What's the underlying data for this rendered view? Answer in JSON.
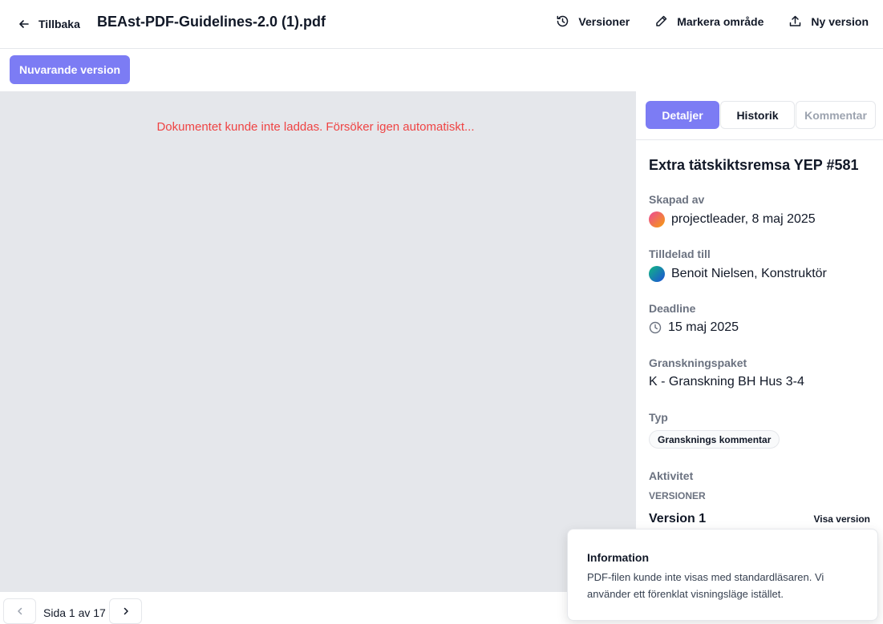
{
  "header": {
    "back_label": "Tillbaka",
    "document_title": "BEAst-PDF-Guidelines-2.0 (1).pdf",
    "actions": {
      "versions": "Versioner",
      "mark_area": "Markera område",
      "new_version": "Ny version"
    }
  },
  "version_bar": {
    "current_version_label": "Nuvarande version"
  },
  "viewer": {
    "error_message": "Dokumentet kunde inte laddas. Försöker igen automatiskt..."
  },
  "pager": {
    "page_label": "Sida 1 av 17"
  },
  "panel": {
    "tabs": {
      "details": "Detaljer",
      "history": "Historik",
      "comment": "Kommentar"
    },
    "issue_title": "Extra tätskiktsremsa YEP #581",
    "created_by": {
      "label": "Skapad av",
      "value": "projectleader, 8 maj 2025"
    },
    "assigned_to": {
      "label": "Tilldelad till",
      "value": "Benoit Nielsen, Konstruktör"
    },
    "deadline": {
      "label": "Deadline",
      "value": "15 maj 2025"
    },
    "review_package": {
      "label": "Granskningspaket",
      "value": "K - Granskning BH Hus 3-4"
    },
    "type": {
      "label": "Typ",
      "value": "Gransknings kommentar"
    },
    "activity": {
      "label": "Aktivitet",
      "versions_heading": "VERSIONER",
      "version_name": "Version 1",
      "view_version": "Visa version"
    }
  },
  "toast": {
    "title": "Information",
    "message": "PDF-filen kunde inte visas med standardläsaren. Vi använder ett förenklat visningsläge istället."
  },
  "colors": {
    "accent": "#7c7cf4",
    "error": "#ef4444",
    "viewer_bg": "#e5e7eb"
  },
  "icons": {
    "back": "arrow-left-icon",
    "versions": "history-icon",
    "mark_area": "pencil-icon",
    "new_version": "upload-icon",
    "prev_page": "chevron-left-icon",
    "next_page": "chevron-right-icon",
    "deadline": "clock-icon"
  }
}
